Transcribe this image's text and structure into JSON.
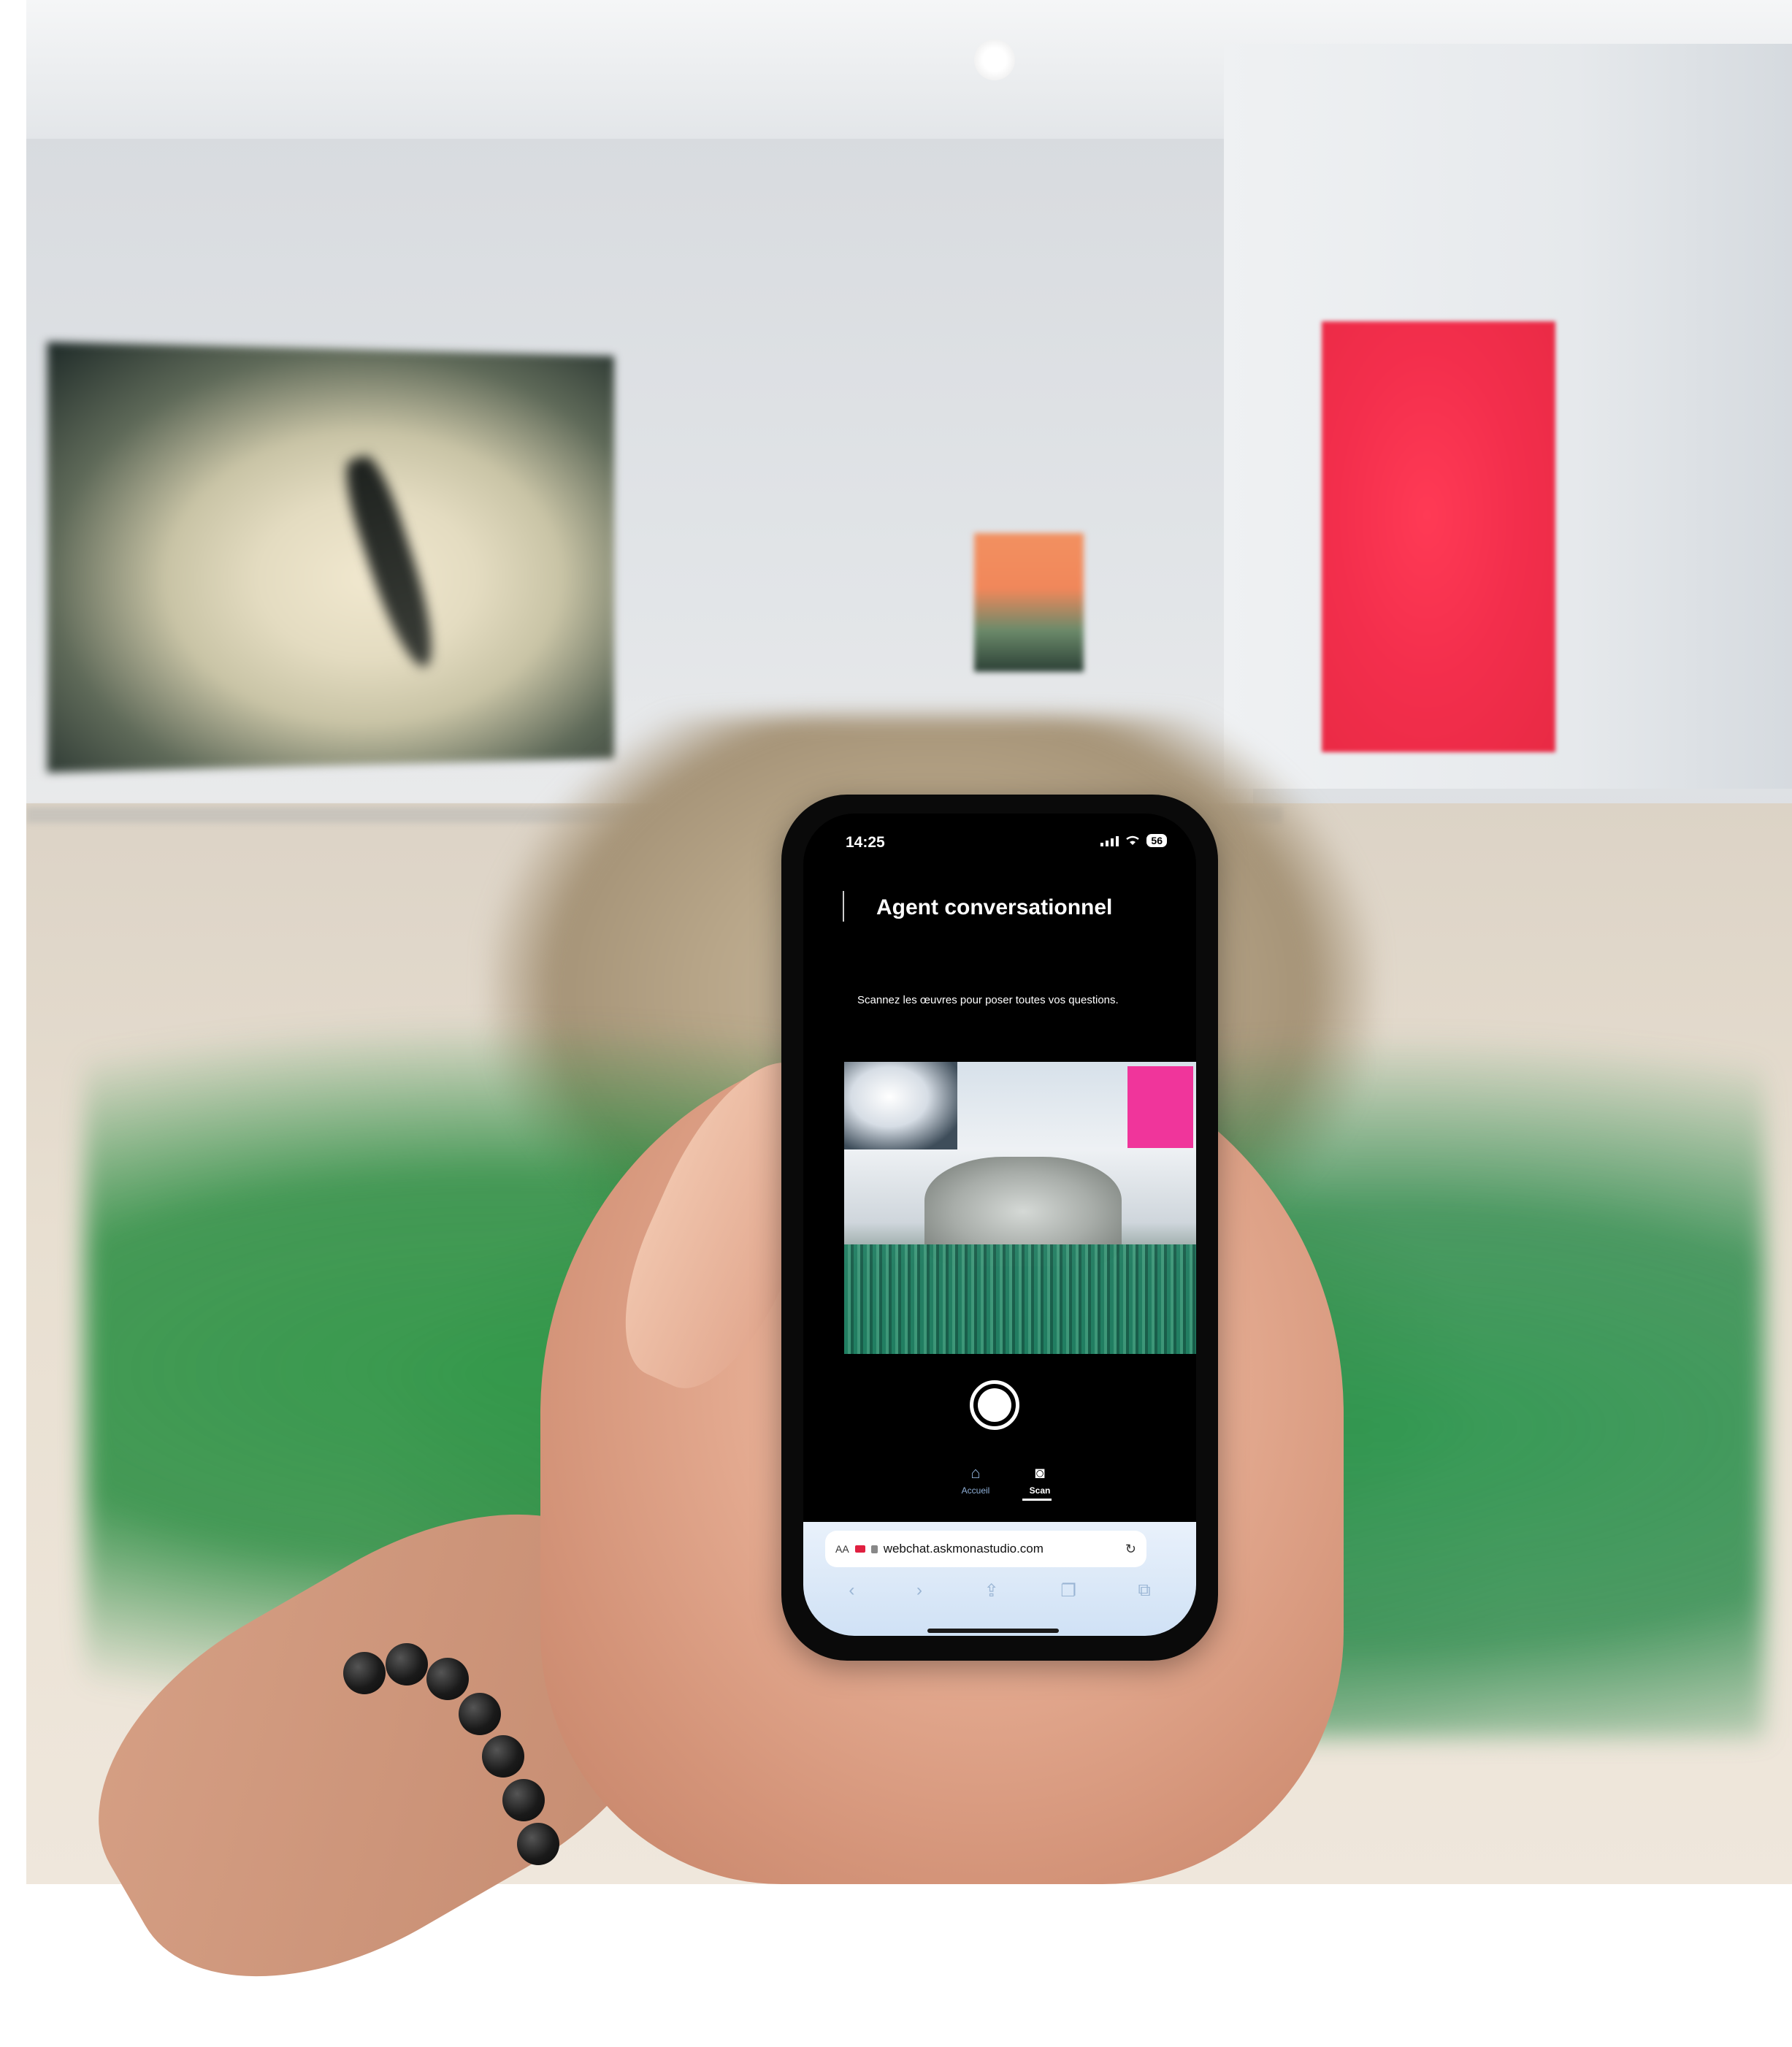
{
  "status_bar": {
    "time": "14:25",
    "battery": "56"
  },
  "app": {
    "title": "Agent conversationnel",
    "instruction": "Scannez les œuvres pour poser toutes vos questions."
  },
  "bottom_nav": {
    "items": [
      {
        "label": "Accueil",
        "icon": "home-icon",
        "active": false
      },
      {
        "label": "Scan",
        "icon": "camera-icon",
        "active": true
      }
    ]
  },
  "browser": {
    "text_size_label": "AA",
    "url": "webchat.askmonastudio.com",
    "toolbar_icons": [
      "back-icon",
      "forward-icon",
      "share-icon",
      "bookmarks-icon",
      "tabs-icon"
    ]
  },
  "colors": {
    "accent_red": "#f32e4c",
    "grass_green": "#2e9646",
    "nav_active": "#ffffff",
    "browser_bar": "#dbe8f7"
  }
}
